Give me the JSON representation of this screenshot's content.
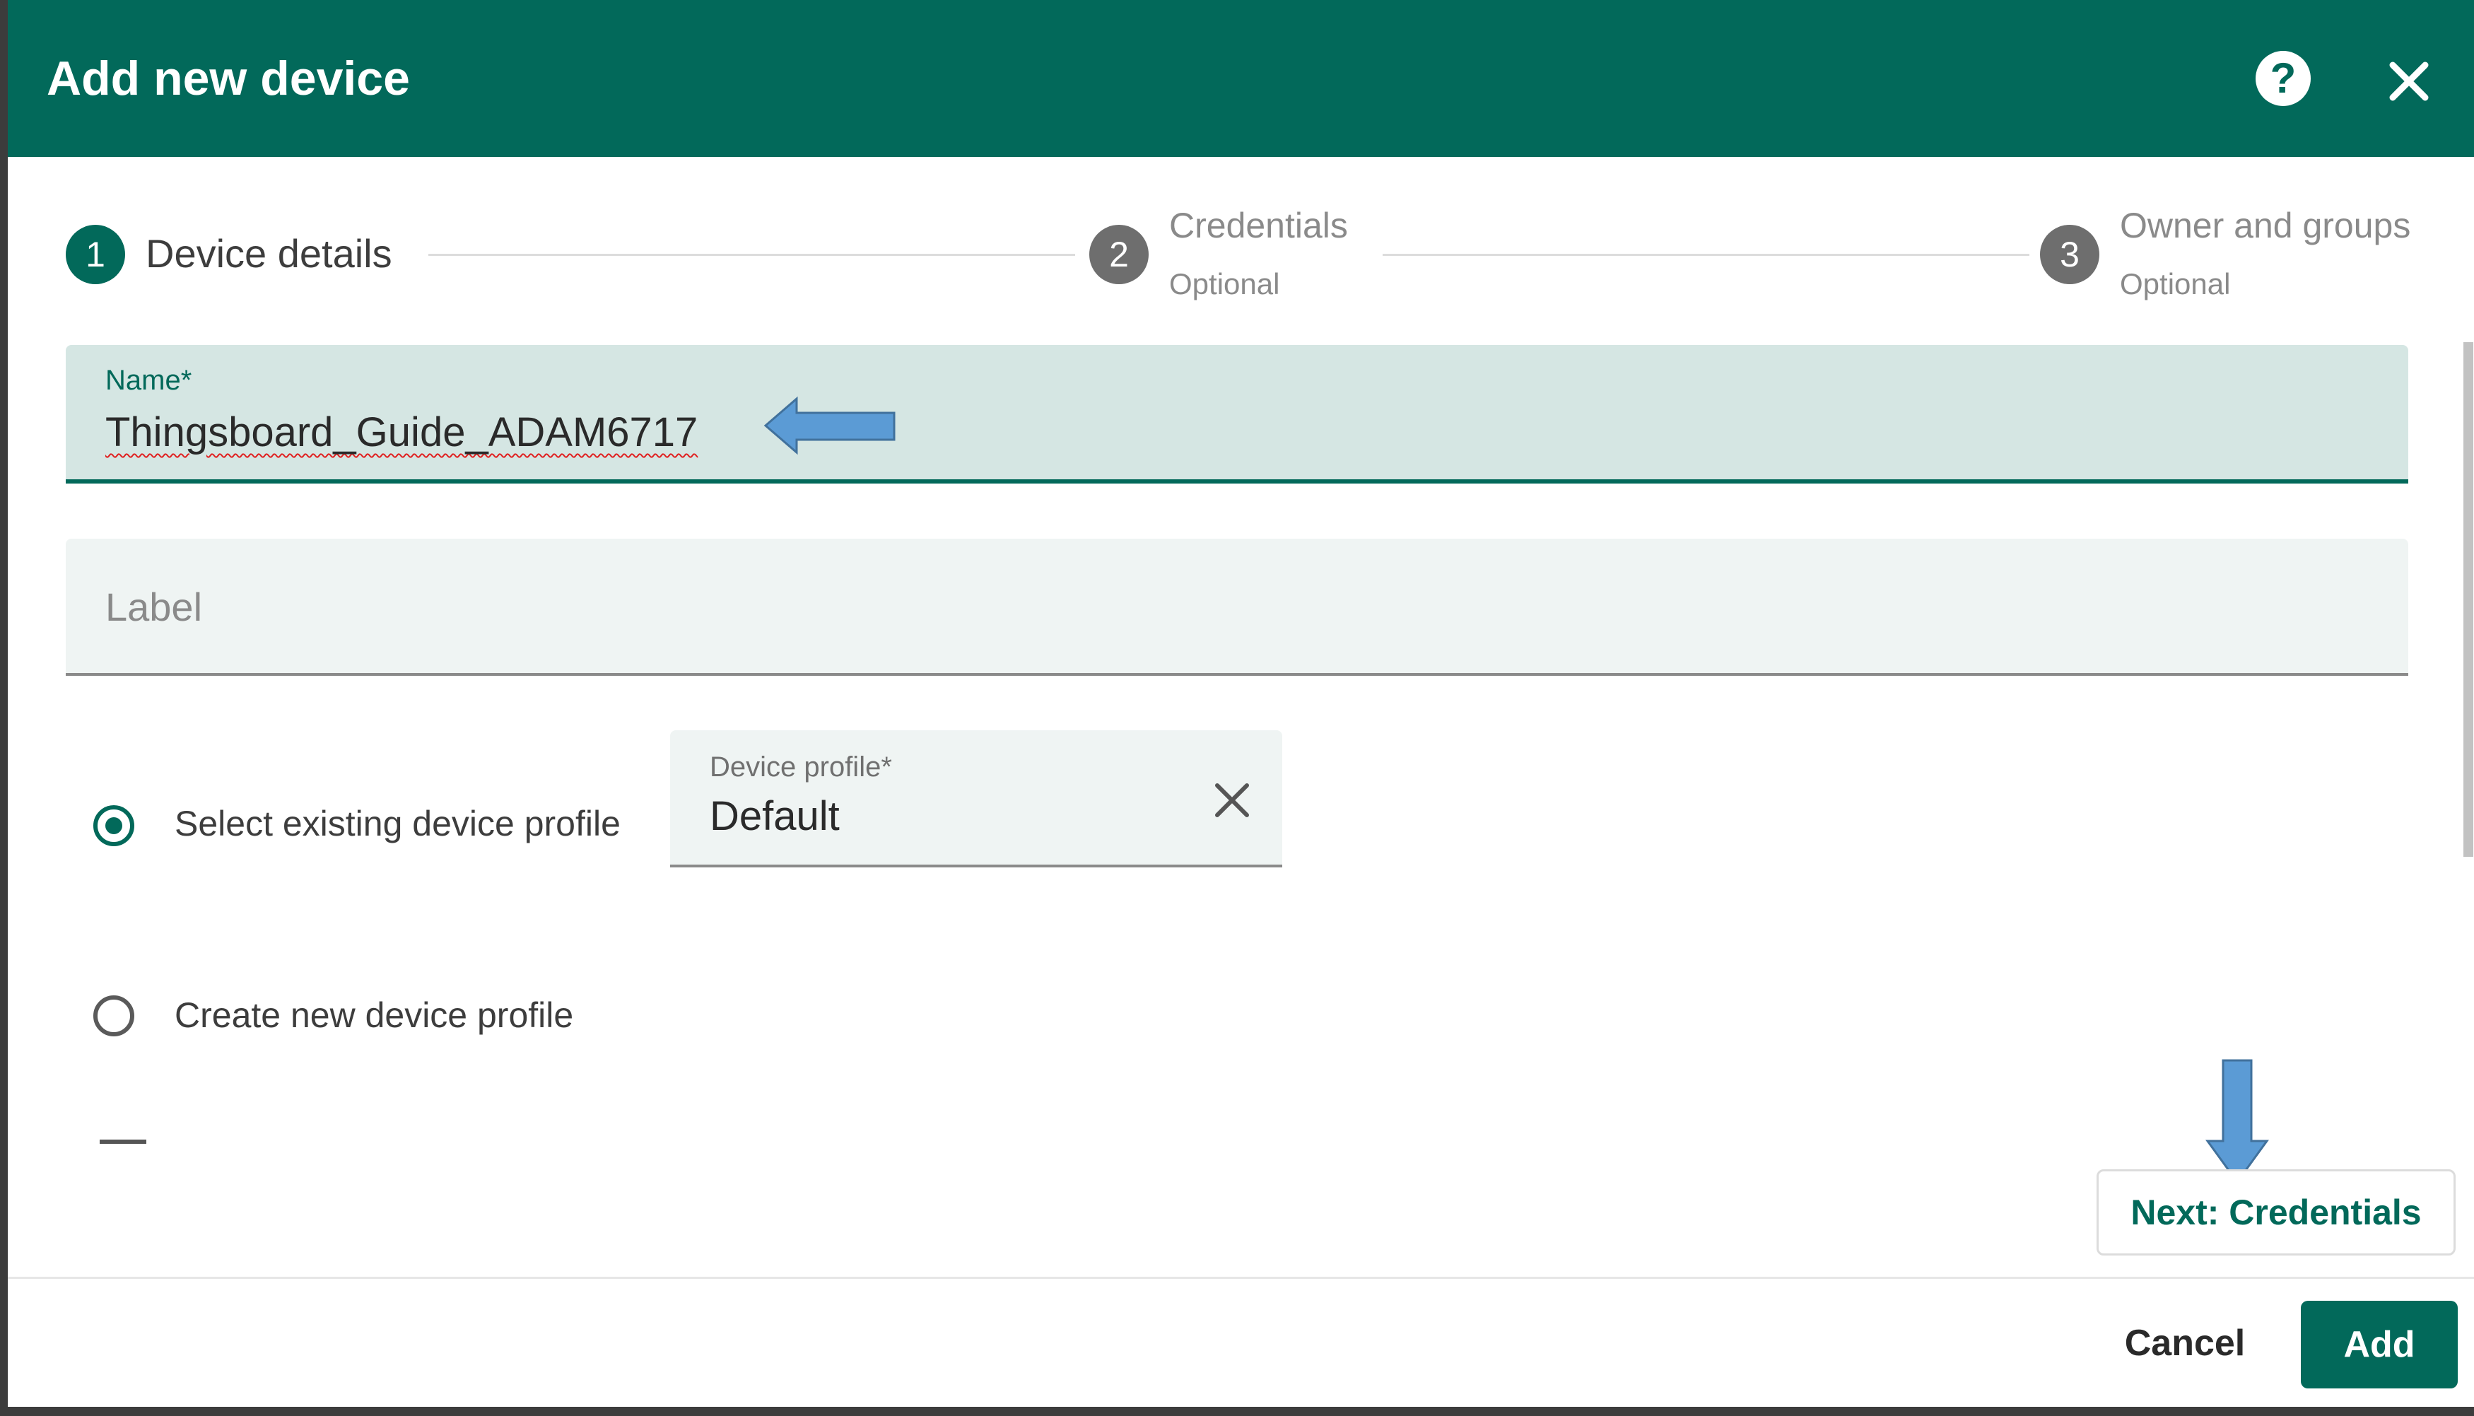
{
  "dialog": {
    "title": "Add new device",
    "help_icon": "help-icon",
    "close_icon": "close-icon"
  },
  "stepper": {
    "steps": [
      {
        "number": "1",
        "label": "Device details",
        "sublabel": "",
        "active": true
      },
      {
        "number": "2",
        "label": "Credentials",
        "sublabel": "Optional",
        "active": false
      },
      {
        "number": "3",
        "label": "Owner and groups",
        "sublabel": "Optional",
        "active": false
      }
    ]
  },
  "form": {
    "name": {
      "label": "Name*",
      "value": "Thingsboard_Guide_ADAM6717"
    },
    "label": {
      "placeholder": "Label",
      "value": ""
    },
    "profile_options": {
      "existing": {
        "label": "Select existing device profile",
        "selected": true
      },
      "create": {
        "label": "Create new device profile",
        "selected": false
      }
    },
    "device_profile": {
      "label": "Device profile*",
      "value": "Default",
      "clear_icon": "close-icon"
    }
  },
  "actions": {
    "next": "Next: Credentials",
    "cancel": "Cancel",
    "add": "Add"
  },
  "colors": {
    "primary": "#02695a",
    "field_bg": "#eff4f3",
    "annotation_arrow": "#5b9bd5"
  }
}
